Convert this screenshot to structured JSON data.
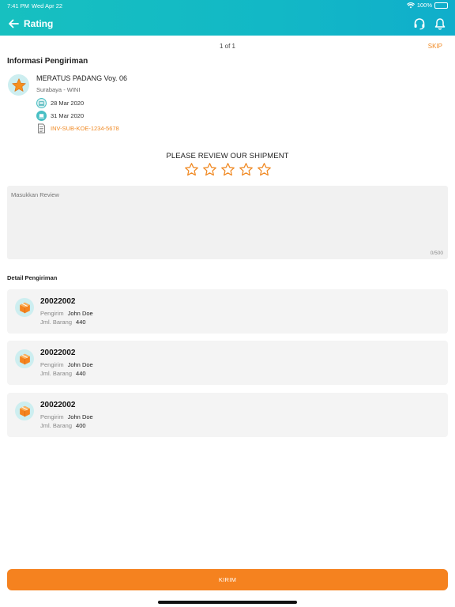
{
  "status_bar": {
    "time": "7:41 PM",
    "date": "Wed Apr 22",
    "battery": "100%"
  },
  "header": {
    "title": "Rating",
    "back_icon": "arrow-left-icon",
    "support_icon": "headset-icon",
    "notification_icon": "bell-icon"
  },
  "pager": {
    "text": "1 of 1",
    "skip_label": "SKIP"
  },
  "shipment_info": {
    "section_title": "Informasi Pengiriman",
    "vessel": "MERATUS PADANG Voy. 06",
    "route": "Surabaya - WINI",
    "departure_date": "28 Mar 2020",
    "arrival_date": "31 Mar 2020",
    "invoice": "INV-SUB-KOE-1234-5678"
  },
  "review": {
    "title": "PLEASE REVIEW OUR SHIPMENT",
    "star_count": 5,
    "rating": 0,
    "placeholder": "Masukkan Review",
    "value": "",
    "counter": "0/500"
  },
  "details": {
    "section_title": "Detail Pengiriman",
    "sender_label": "Pengirim",
    "qty_label": "Jml. Barang",
    "items": [
      {
        "code": "20022002",
        "sender": "John Doe",
        "qty": "440"
      },
      {
        "code": "20022002",
        "sender": "John Doe",
        "qty": "440"
      },
      {
        "code": "20022002",
        "sender": "John Doe",
        "qty": "400"
      }
    ]
  },
  "submit": {
    "label": "KIRIM"
  },
  "colors": {
    "header_start": "#17c0c0",
    "header_end": "#10aecb",
    "accent_orange": "#f5821f",
    "star_orange": "#f08a24"
  }
}
